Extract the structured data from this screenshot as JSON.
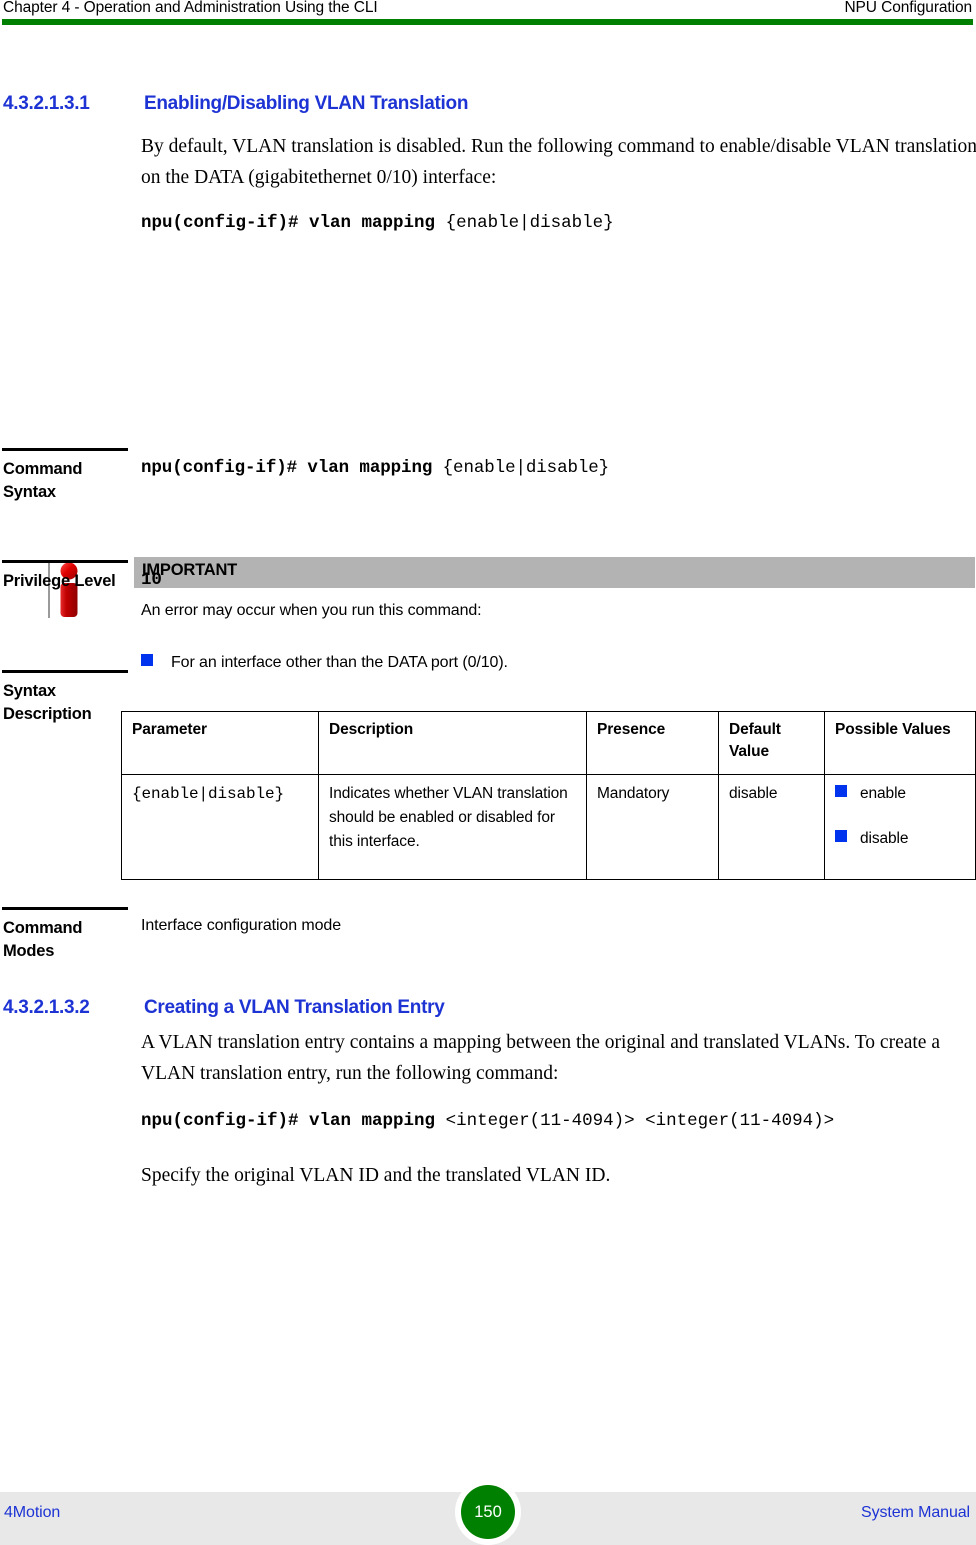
{
  "header": {
    "left": "Chapter 4 - Operation and Administration Using the CLI",
    "right": "NPU Configuration",
    "rule_color": "#008000"
  },
  "sections": [
    {
      "number": "4.3.2.1.3.1",
      "title": "Enabling/Disabling VLAN Translation",
      "paragraph": "By default, VLAN translation is disabled. Run the following command to enable/disable VLAN translation on the DATA (gigabitethernet 0/10) interface:",
      "command_bold": "npu(config-if)# vlan mapping ",
      "command_plain": "{enable|disable}"
    },
    {
      "number": "4.3.2.1.3.2",
      "title": "Creating a VLAN Translation Entry",
      "paragraph": "A VLAN translation entry contains a mapping between the original and translated VLANs. To create a VLAN translation entry, run the following command:",
      "command_bold": "npu(config-if)# vlan mapping ",
      "command_plain": "<integer(11-4094)> <integer(11-4094)>",
      "closing_paragraph": "Specify the original VLAN ID and the translated VLAN ID."
    }
  ],
  "callout": {
    "icon": "important-info-icon",
    "title": "IMPORTANT",
    "body": "An error may occur when you run this command:",
    "bullets": [
      "For an interface other than the DATA port (0/10)."
    ],
    "bar_color": "#b3b3b3",
    "bullet_color": "#0033ee"
  },
  "fields": {
    "command_syntax": {
      "label": "Command Syntax",
      "value_bold": "npu(config-if)# vlan mapping ",
      "value_plain": "{enable|disable}"
    },
    "privilege_level": {
      "label": "Privilege Level",
      "value": "10"
    },
    "syntax_description": {
      "label": "Syntax Description"
    },
    "command_modes": {
      "label": "Command Modes",
      "value": "Interface configuration mode"
    }
  },
  "syntax_table": {
    "columns": [
      "Parameter",
      "Description",
      "Presence",
      "Default Value",
      "Possible Values"
    ],
    "rows": [
      {
        "parameter": "{enable|disable}",
        "description": "Indicates whether VLAN translation should be enabled or disabled for this interface.",
        "presence": "Mandatory",
        "default_value": "disable",
        "possible_values": [
          "enable",
          "disable"
        ]
      }
    ]
  },
  "footer": {
    "left": "4Motion",
    "page_number": "150",
    "right": "System Manual",
    "page_badge_color": "#008000",
    "band_color": "#e8e8e8"
  }
}
